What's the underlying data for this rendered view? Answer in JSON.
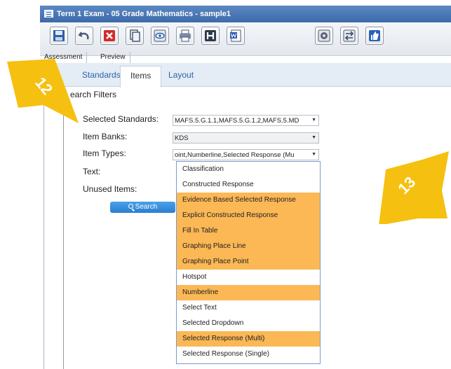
{
  "window": {
    "title": "Term 1 Exam - 05 Grade Mathematics - sample1"
  },
  "toolbar": {
    "buttons": [
      "save-icon",
      "undo-icon",
      "delete-icon",
      "copy-icon",
      "preview-eye-icon",
      "print-icon",
      "h-heading-icon",
      "word-export-icon",
      "settings-gear-icon",
      "swap-icon",
      "thumbs-up-icon"
    ]
  },
  "subtabs": [
    "Assessment",
    "Preview"
  ],
  "tabs": [
    "Standards",
    "Items",
    "Layout"
  ],
  "section_title": "earch Filters",
  "filters": {
    "standards_label": "Selected Standards:",
    "standards_value": "MAFS.5.G.1.1,MAFS.5.G.1.2,MAFS.5.MD",
    "banks_label": "Item Banks:",
    "banks_value": "KDS",
    "types_label": "Item Types:",
    "types_value": "oint,Numberline,Selected Response (Mu",
    "text_label": "Text:",
    "unused_label": "Unused Items:",
    "search_label": "Search"
  },
  "dropdown_options": [
    {
      "label": "Classification",
      "selected": false
    },
    {
      "label": "Constructed Response",
      "selected": false
    },
    {
      "label": "Evidence Based Selected Response",
      "selected": true
    },
    {
      "label": "Explicit Constructed Response",
      "selected": true
    },
    {
      "label": "Fill In Table",
      "selected": true
    },
    {
      "label": "Graphing Place Line",
      "selected": true
    },
    {
      "label": "Graphing Place Point",
      "selected": true
    },
    {
      "label": "Hotspot",
      "selected": false
    },
    {
      "label": "Numberline",
      "selected": true
    },
    {
      "label": "Select Text",
      "selected": false
    },
    {
      "label": "Selected Dropdown",
      "selected": false
    },
    {
      "label": "Selected Response (Multi)",
      "selected": true
    },
    {
      "label": "Selected Response (Single)",
      "selected": false
    }
  ],
  "callouts": {
    "left": "12",
    "right": "13"
  },
  "colors": {
    "highlight": "#fbb855",
    "callout": "#f5c010",
    "tab_link": "#2f64a8",
    "search_button": "#2b7fcf"
  }
}
